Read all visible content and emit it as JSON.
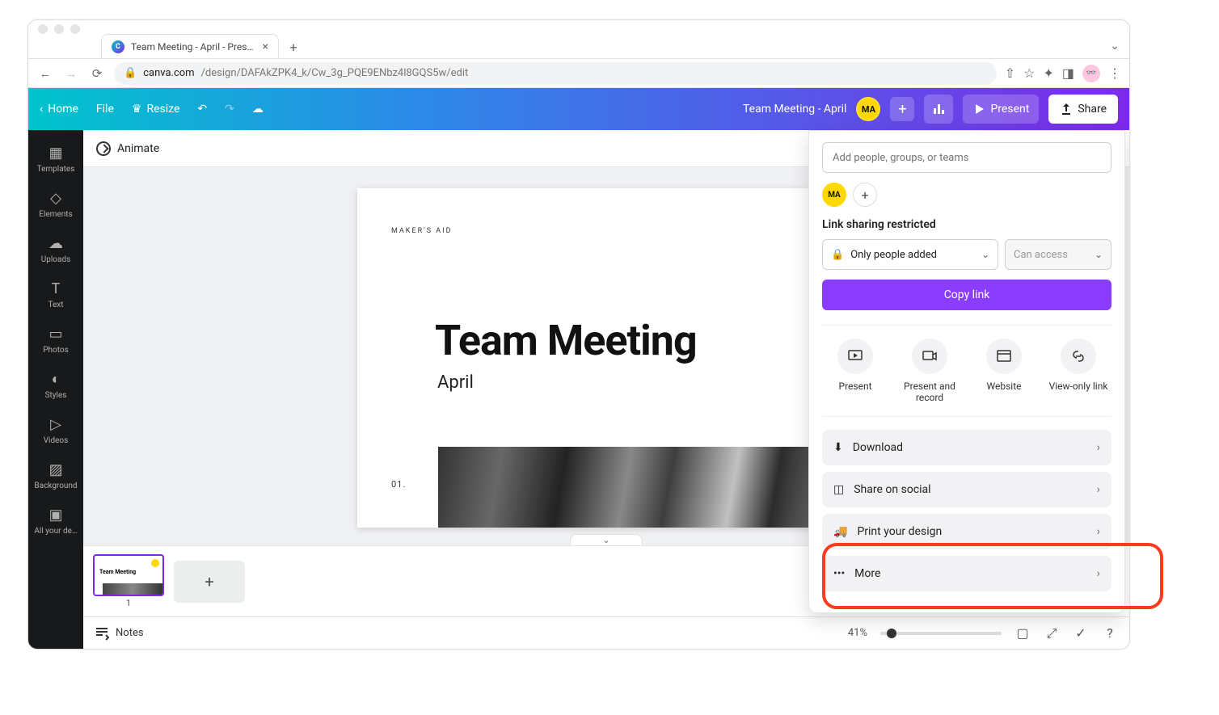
{
  "browser": {
    "tab_title": "Team Meeting - April - Present…",
    "url_host": "canva.com",
    "url_path": "/design/DAFAkZPK4_k/Cw_3g_PQE9ENbz4l8GQS5w/edit"
  },
  "topbar": {
    "home": "Home",
    "file": "File",
    "resize": "Resize",
    "doc_title": "Team Meeting - April",
    "avatar_initials": "MA",
    "present": "Present",
    "share": "Share"
  },
  "sidebar": {
    "items": [
      {
        "label": "Templates"
      },
      {
        "label": "Elements"
      },
      {
        "label": "Uploads"
      },
      {
        "label": "Text"
      },
      {
        "label": "Photos"
      },
      {
        "label": "Styles"
      },
      {
        "label": "Videos"
      },
      {
        "label": "Background"
      },
      {
        "label": "All your de…"
      }
    ]
  },
  "context": {
    "animate": "Animate"
  },
  "slide": {
    "brand": "MAKER'S AID",
    "title": "Team Meeting",
    "subtitle": "April",
    "page_num": "01."
  },
  "thumbs": {
    "current_index": "1",
    "t_title": "Team Meeting"
  },
  "bottombar": {
    "notes": "Notes",
    "zoom": "41%"
  },
  "share_panel": {
    "placeholder": "Add people, groups, or teams",
    "avatar_initials": "MA",
    "link_heading": "Link sharing restricted",
    "access_select": "Only people added",
    "perm_select": "Can access",
    "copy_link": "Copy link",
    "options": [
      {
        "label": "Present"
      },
      {
        "label": "Present and record"
      },
      {
        "label": "Website"
      },
      {
        "label": "View-only link"
      }
    ],
    "actions": [
      {
        "label": "Download"
      },
      {
        "label": "Share on social"
      },
      {
        "label": "Print your design"
      },
      {
        "label": "More"
      }
    ]
  }
}
